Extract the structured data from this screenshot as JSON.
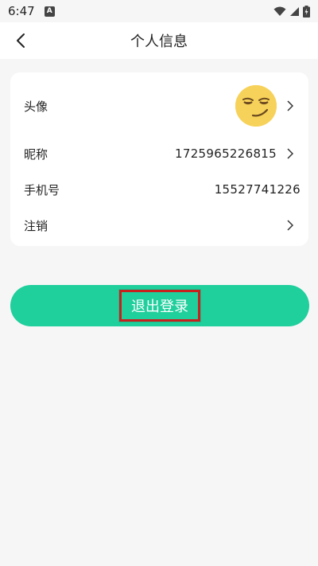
{
  "status_bar": {
    "time": "6:47",
    "notification_badge": "A",
    "icons": [
      "wifi-icon",
      "signal-icon",
      "battery-charging-icon"
    ]
  },
  "header": {
    "title": "个人信息",
    "back_icon": "back-arrow-icon"
  },
  "profile": {
    "avatar_label": "头像",
    "avatar_icon": "smirk-emoji-icon",
    "nickname_label": "昵称",
    "nickname_value": "1725965226815",
    "phone_label": "手机号",
    "phone_value": "15527741226",
    "deregister_label": "注销"
  },
  "actions": {
    "logout_label": "退出登录"
  },
  "colors": {
    "accent": "#1fcf9c",
    "highlight_border": "#c8201d",
    "avatar_bg": "#f7d25a"
  }
}
